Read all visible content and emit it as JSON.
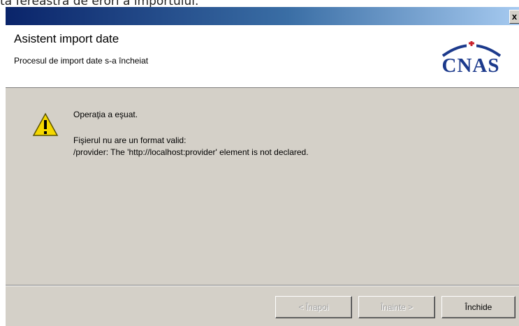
{
  "document_caption": "ta fereastra de erori a importului.",
  "window": {
    "close_glyph": "x",
    "title": "Asistent import date",
    "subtitle": "Procesul de import date s-a încheiat",
    "logo_text": "CNAS"
  },
  "message": {
    "title": "Operaţia a eşuat.",
    "line1": "Fişierul nu are un format valid:",
    "line2": "/provider: The 'http://localhost:provider' element is not declared."
  },
  "buttons": {
    "prev": "< Înapoi",
    "next": "Înainte >",
    "close": "Închide"
  },
  "colors": {
    "logo_blue": "#1c3a8c",
    "logo_red": "#c8202a"
  }
}
